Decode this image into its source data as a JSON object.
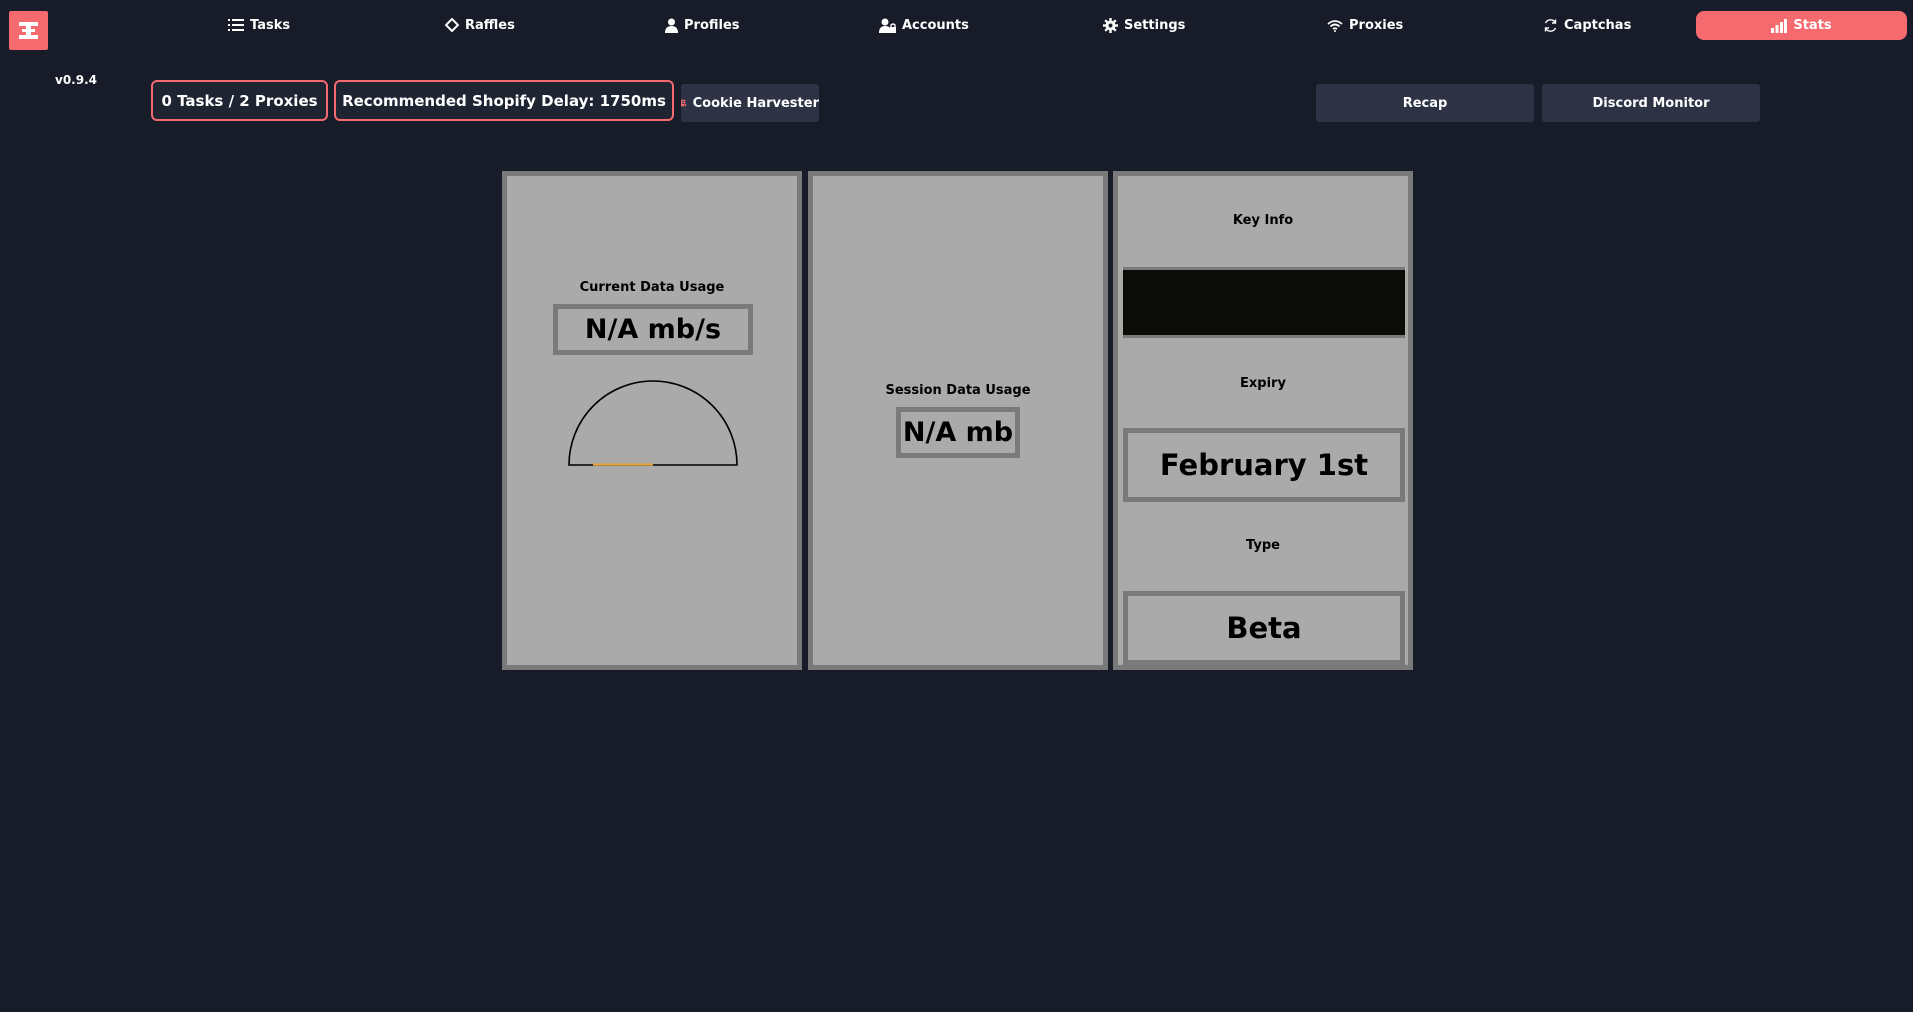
{
  "nav": {
    "logo_icon": "brand-logo-icon",
    "items": [
      {
        "label": "Tasks",
        "icon": "list-icon"
      },
      {
        "label": "Raffles",
        "icon": "ticket-icon"
      },
      {
        "label": "Profiles",
        "icon": "user-icon"
      },
      {
        "label": "Accounts",
        "icon": "user-lock-icon"
      },
      {
        "label": "Settings",
        "icon": "gear-icon"
      },
      {
        "label": "Proxies",
        "icon": "wifi-icon"
      },
      {
        "label": "Captchas",
        "icon": "refresh-icon"
      }
    ],
    "active": {
      "label": "Stats",
      "icon": "chart-icon"
    }
  },
  "toolbar": {
    "version": "v0.9.4",
    "tasks_proxies": "0 Tasks / 2 Proxies",
    "shopify_delay": "Recommended Shopify Delay: 1750ms",
    "cookie_harvester": "Cookie Harvester",
    "recap": "Recap",
    "discord_monitor": "Discord Monitor"
  },
  "panels": {
    "current": {
      "label": "Current Data Usage",
      "value": "N/A mb/s",
      "gauge_fraction": 0
    },
    "session": {
      "label": "Session Data Usage",
      "value": "N/A mb"
    },
    "key": {
      "key_label": "Key Info",
      "expiry_label": "Expiry",
      "expiry_value": "February 1st",
      "type_label": "Type",
      "type_value": "Beta"
    }
  },
  "colors": {
    "background": "#181b28",
    "accent": "#f46a6f",
    "panel": "#aaaaaa",
    "panel_border": "#7a7a7a",
    "gauge_accent": "#e8a33a"
  }
}
